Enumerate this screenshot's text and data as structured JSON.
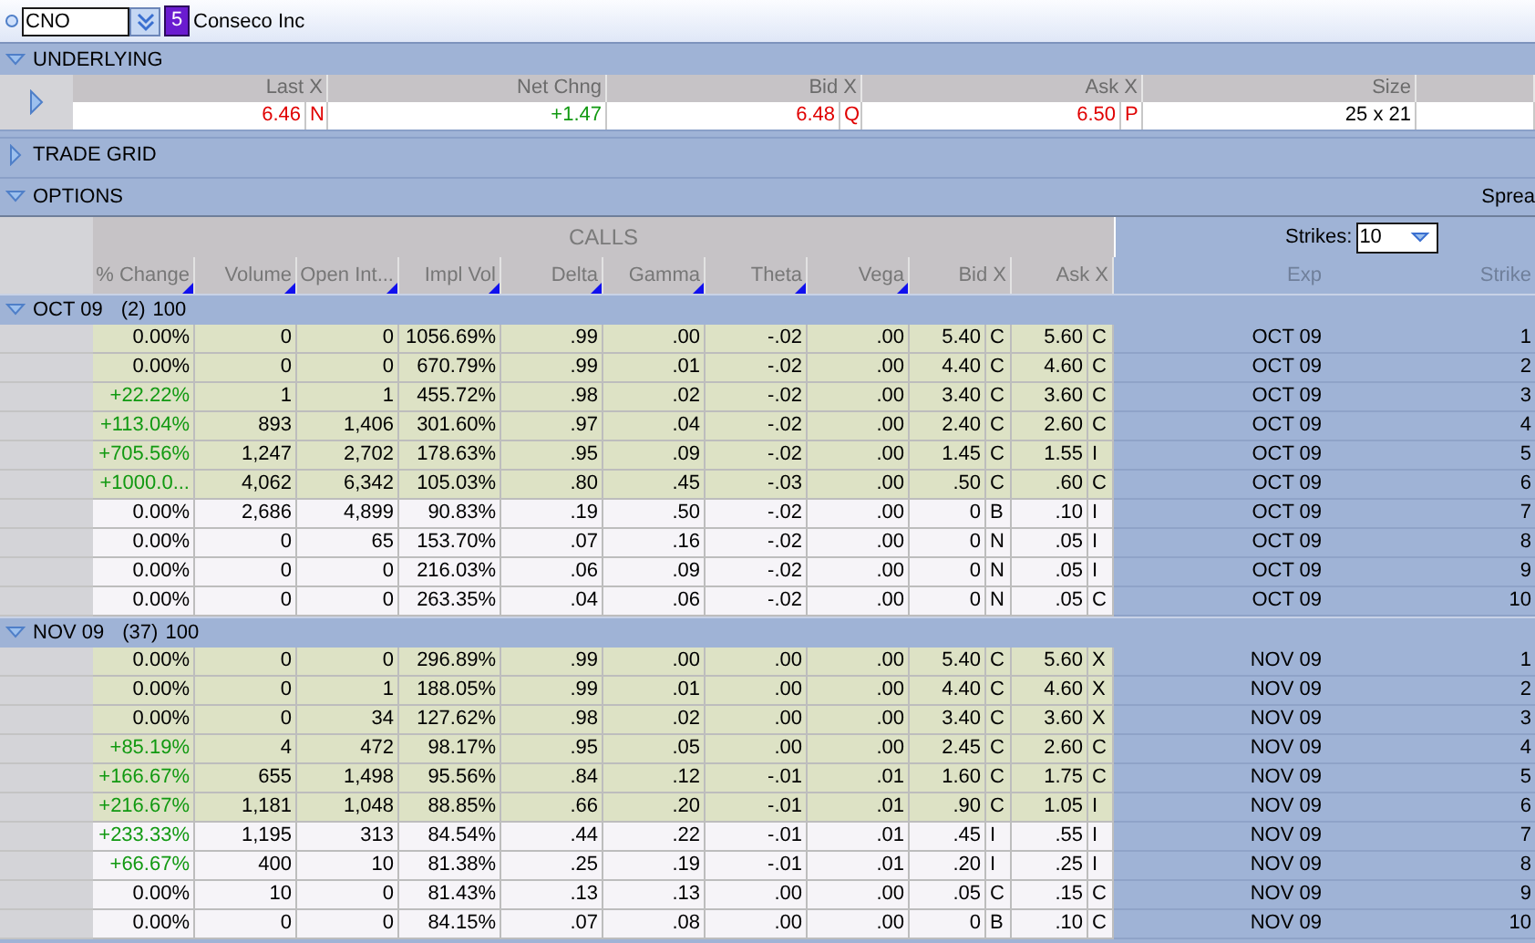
{
  "symbol_bar": {
    "symbol": "CNO",
    "badge": "5",
    "company": "Conseco Inc"
  },
  "underlying": {
    "title": "UNDERLYING",
    "expanded": true,
    "row_expanded": false,
    "columns": [
      "Last X",
      "Net Chng",
      "Bid X",
      "Ask X",
      "Size"
    ],
    "last": "6.46",
    "last_x": "N",
    "net_chng": "+1.47",
    "bid": "6.48",
    "bid_x": "Q",
    "ask": "6.50",
    "ask_x": "P",
    "size": "25 x 21"
  },
  "trade_grid": {
    "title": "TRADE GRID",
    "expanded": false
  },
  "options": {
    "title": "OPTIONS",
    "expanded": true,
    "spread_label": "Sprea",
    "calls_label": "CALLS",
    "strikes_label": "Strikes:",
    "strikes_value": "10",
    "columns": [
      "% Change",
      "Volume",
      "Open Int...",
      "Impl Vol",
      "Delta",
      "Gamma",
      "Theta",
      "Vega",
      "Bid X",
      "Ask X",
      "Exp",
      "Strike"
    ],
    "groups": [
      {
        "label": "OCT 09",
        "count": "(2)",
        "size": "100",
        "expanded": true,
        "rows": [
          {
            "change": "0.00%",
            "change_up": false,
            "volume": "0",
            "open_int": "0",
            "impl_vol": "1056.69%",
            "delta": ".99",
            "gamma": ".00",
            "theta": "-.02",
            "vega": ".00",
            "bid": "5.40",
            "bid_x": "C",
            "ask": "5.60",
            "ask_x": "C",
            "exp": "OCT 09",
            "strike": "1",
            "in_the_money": true
          },
          {
            "change": "0.00%",
            "change_up": false,
            "volume": "0",
            "open_int": "0",
            "impl_vol": "670.79%",
            "delta": ".99",
            "gamma": ".01",
            "theta": "-.02",
            "vega": ".00",
            "bid": "4.40",
            "bid_x": "C",
            "ask": "4.60",
            "ask_x": "C",
            "exp": "OCT 09",
            "strike": "2",
            "in_the_money": true
          },
          {
            "change": "+22.22%",
            "change_up": true,
            "volume": "1",
            "open_int": "1",
            "impl_vol": "455.72%",
            "delta": ".98",
            "gamma": ".02",
            "theta": "-.02",
            "vega": ".00",
            "bid": "3.40",
            "bid_x": "C",
            "ask": "3.60",
            "ask_x": "C",
            "exp": "OCT 09",
            "strike": "3",
            "in_the_money": true
          },
          {
            "change": "+113.04%",
            "change_up": true,
            "volume": "893",
            "open_int": "1,406",
            "impl_vol": "301.60%",
            "delta": ".97",
            "gamma": ".04",
            "theta": "-.02",
            "vega": ".00",
            "bid": "2.40",
            "bid_x": "C",
            "ask": "2.60",
            "ask_x": "C",
            "exp": "OCT 09",
            "strike": "4",
            "in_the_money": true
          },
          {
            "change": "+705.56%",
            "change_up": true,
            "volume": "1,247",
            "open_int": "2,702",
            "impl_vol": "178.63%",
            "delta": ".95",
            "gamma": ".09",
            "theta": "-.02",
            "vega": ".00",
            "bid": "1.45",
            "bid_x": "C",
            "ask": "1.55",
            "ask_x": "I",
            "exp": "OCT 09",
            "strike": "5",
            "in_the_money": true
          },
          {
            "change": "+1000.0...",
            "change_up": true,
            "volume": "4,062",
            "open_int": "6,342",
            "impl_vol": "105.03%",
            "delta": ".80",
            "gamma": ".45",
            "theta": "-.03",
            "vega": ".00",
            "bid": ".50",
            "bid_x": "C",
            "ask": ".60",
            "ask_x": "C",
            "exp": "OCT 09",
            "strike": "6",
            "in_the_money": true
          },
          {
            "change": "0.00%",
            "change_up": false,
            "volume": "2,686",
            "open_int": "4,899",
            "impl_vol": "90.83%",
            "delta": ".19",
            "gamma": ".50",
            "theta": "-.02",
            "vega": ".00",
            "bid": "0",
            "bid_x": "B",
            "ask": ".10",
            "ask_x": "I",
            "exp": "OCT 09",
            "strike": "7",
            "in_the_money": false
          },
          {
            "change": "0.00%",
            "change_up": false,
            "volume": "0",
            "open_int": "65",
            "impl_vol": "153.70%",
            "delta": ".07",
            "gamma": ".16",
            "theta": "-.02",
            "vega": ".00",
            "bid": "0",
            "bid_x": "N",
            "ask": ".05",
            "ask_x": "I",
            "exp": "OCT 09",
            "strike": "8",
            "in_the_money": false
          },
          {
            "change": "0.00%",
            "change_up": false,
            "volume": "0",
            "open_int": "0",
            "impl_vol": "216.03%",
            "delta": ".06",
            "gamma": ".09",
            "theta": "-.02",
            "vega": ".00",
            "bid": "0",
            "bid_x": "N",
            "ask": ".05",
            "ask_x": "I",
            "exp": "OCT 09",
            "strike": "9",
            "in_the_money": false
          },
          {
            "change": "0.00%",
            "change_up": false,
            "volume": "0",
            "open_int": "0",
            "impl_vol": "263.35%",
            "delta": ".04",
            "gamma": ".06",
            "theta": "-.02",
            "vega": ".00",
            "bid": "0",
            "bid_x": "N",
            "ask": ".05",
            "ask_x": "C",
            "exp": "OCT 09",
            "strike": "10",
            "in_the_money": false
          }
        ]
      },
      {
        "label": "NOV 09",
        "count": "(37)",
        "size": "100",
        "expanded": true,
        "rows": [
          {
            "change": "0.00%",
            "change_up": false,
            "volume": "0",
            "open_int": "0",
            "impl_vol": "296.89%",
            "delta": ".99",
            "gamma": ".00",
            "theta": ".00",
            "vega": ".00",
            "bid": "5.40",
            "bid_x": "C",
            "ask": "5.60",
            "ask_x": "X",
            "exp": "NOV 09",
            "strike": "1",
            "in_the_money": true
          },
          {
            "change": "0.00%",
            "change_up": false,
            "volume": "0",
            "open_int": "1",
            "impl_vol": "188.05%",
            "delta": ".99",
            "gamma": ".01",
            "theta": ".00",
            "vega": ".00",
            "bid": "4.40",
            "bid_x": "C",
            "ask": "4.60",
            "ask_x": "X",
            "exp": "NOV 09",
            "strike": "2",
            "in_the_money": true
          },
          {
            "change": "0.00%",
            "change_up": false,
            "volume": "0",
            "open_int": "34",
            "impl_vol": "127.62%",
            "delta": ".98",
            "gamma": ".02",
            "theta": ".00",
            "vega": ".00",
            "bid": "3.40",
            "bid_x": "C",
            "ask": "3.60",
            "ask_x": "X",
            "exp": "NOV 09",
            "strike": "3",
            "in_the_money": true
          },
          {
            "change": "+85.19%",
            "change_up": true,
            "volume": "4",
            "open_int": "472",
            "impl_vol": "98.17%",
            "delta": ".95",
            "gamma": ".05",
            "theta": ".00",
            "vega": ".00",
            "bid": "2.45",
            "bid_x": "C",
            "ask": "2.60",
            "ask_x": "C",
            "exp": "NOV 09",
            "strike": "4",
            "in_the_money": true
          },
          {
            "change": "+166.67%",
            "change_up": true,
            "volume": "655",
            "open_int": "1,498",
            "impl_vol": "95.56%",
            "delta": ".84",
            "gamma": ".12",
            "theta": "-.01",
            "vega": ".01",
            "bid": "1.60",
            "bid_x": "C",
            "ask": "1.75",
            "ask_x": "C",
            "exp": "NOV 09",
            "strike": "5",
            "in_the_money": true
          },
          {
            "change": "+216.67%",
            "change_up": true,
            "volume": "1,181",
            "open_int": "1,048",
            "impl_vol": "88.85%",
            "delta": ".66",
            "gamma": ".20",
            "theta": "-.01",
            "vega": ".01",
            "bid": ".90",
            "bid_x": "C",
            "ask": "1.05",
            "ask_x": "I",
            "exp": "NOV 09",
            "strike": "6",
            "in_the_money": true
          },
          {
            "change": "+233.33%",
            "change_up": true,
            "volume": "1,195",
            "open_int": "313",
            "impl_vol": "84.54%",
            "delta": ".44",
            "gamma": ".22",
            "theta": "-.01",
            "vega": ".01",
            "bid": ".45",
            "bid_x": "I",
            "ask": ".55",
            "ask_x": "I",
            "exp": "NOV 09",
            "strike": "7",
            "in_the_money": false
          },
          {
            "change": "+66.67%",
            "change_up": true,
            "volume": "400",
            "open_int": "10",
            "impl_vol": "81.38%",
            "delta": ".25",
            "gamma": ".19",
            "theta": "-.01",
            "vega": ".01",
            "bid": ".20",
            "bid_x": "I",
            "ask": ".25",
            "ask_x": "I",
            "exp": "NOV 09",
            "strike": "8",
            "in_the_money": false
          },
          {
            "change": "0.00%",
            "change_up": false,
            "volume": "10",
            "open_int": "0",
            "impl_vol": "81.43%",
            "delta": ".13",
            "gamma": ".13",
            "theta": ".00",
            "vega": ".00",
            "bid": ".05",
            "bid_x": "C",
            "ask": ".15",
            "ask_x": "C",
            "exp": "NOV 09",
            "strike": "9",
            "in_the_money": false
          },
          {
            "change": "0.00%",
            "change_up": false,
            "volume": "0",
            "open_int": "0",
            "impl_vol": "84.15%",
            "delta": ".07",
            "gamma": ".08",
            "theta": ".00",
            "vega": ".00",
            "bid": "0",
            "bid_x": "B",
            "ask": ".10",
            "ask_x": "C",
            "exp": "NOV 09",
            "strike": "10",
            "in_the_money": false
          }
        ]
      }
    ]
  }
}
